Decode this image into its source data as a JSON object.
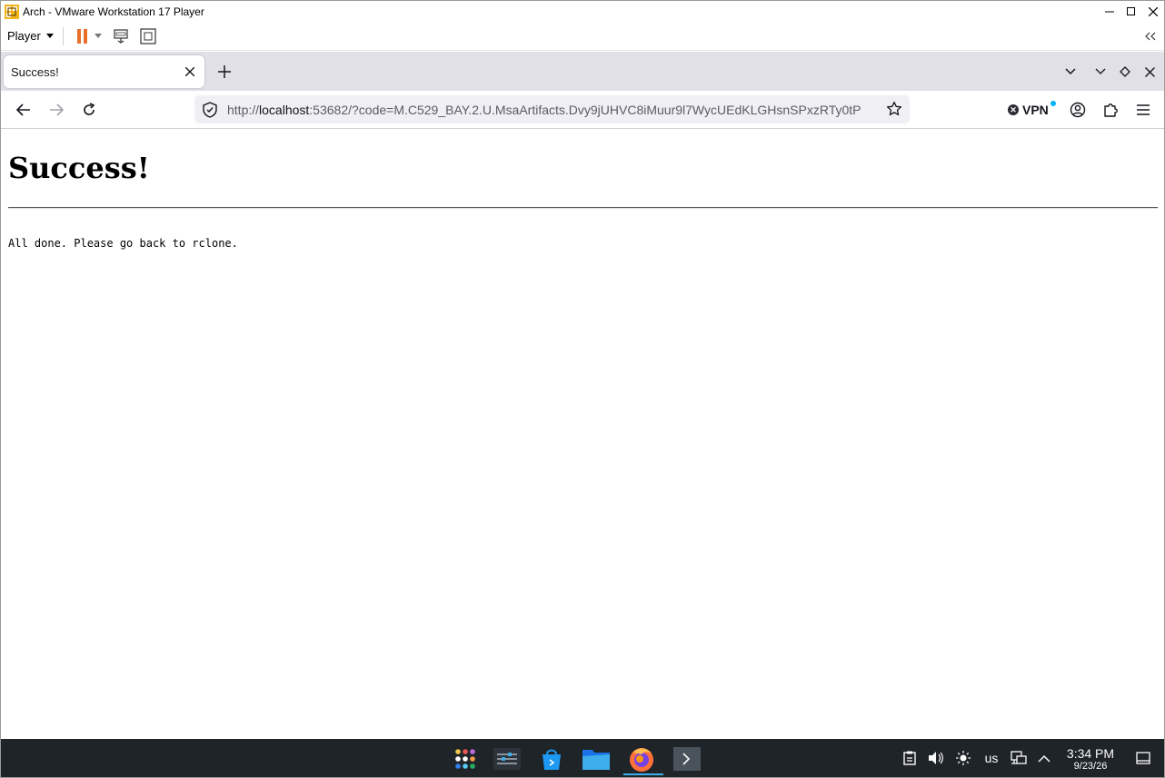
{
  "vmware": {
    "window_title": "Arch - VMware Workstation 17 Player",
    "player_menu_label": "Player"
  },
  "browser": {
    "tab": {
      "title": "Success!"
    },
    "url": {
      "scheme_prefix": "http://",
      "host": "localhost",
      "rest": ":53682/?code=M.C529_BAY.2.U.MsaArtifacts.Dvy9jUHVC8iMuur9l7WycUEdKLGHsnSPxzRTy0tP"
    },
    "vpn_label": "VPN"
  },
  "page": {
    "heading": "Success!",
    "message": "All done. Please go back to rclone."
  },
  "taskbar": {
    "keyboard_layout": "us",
    "time": "3:34 PM",
    "date": "9/23/26"
  },
  "colors": {
    "taskbar_bg": "#1f2429",
    "firefox_tabstrip": "#e0e0e6",
    "urlbar_bg": "#f0f0f4",
    "accent": "#3daee9",
    "vmware_pause": "#e8702a"
  }
}
